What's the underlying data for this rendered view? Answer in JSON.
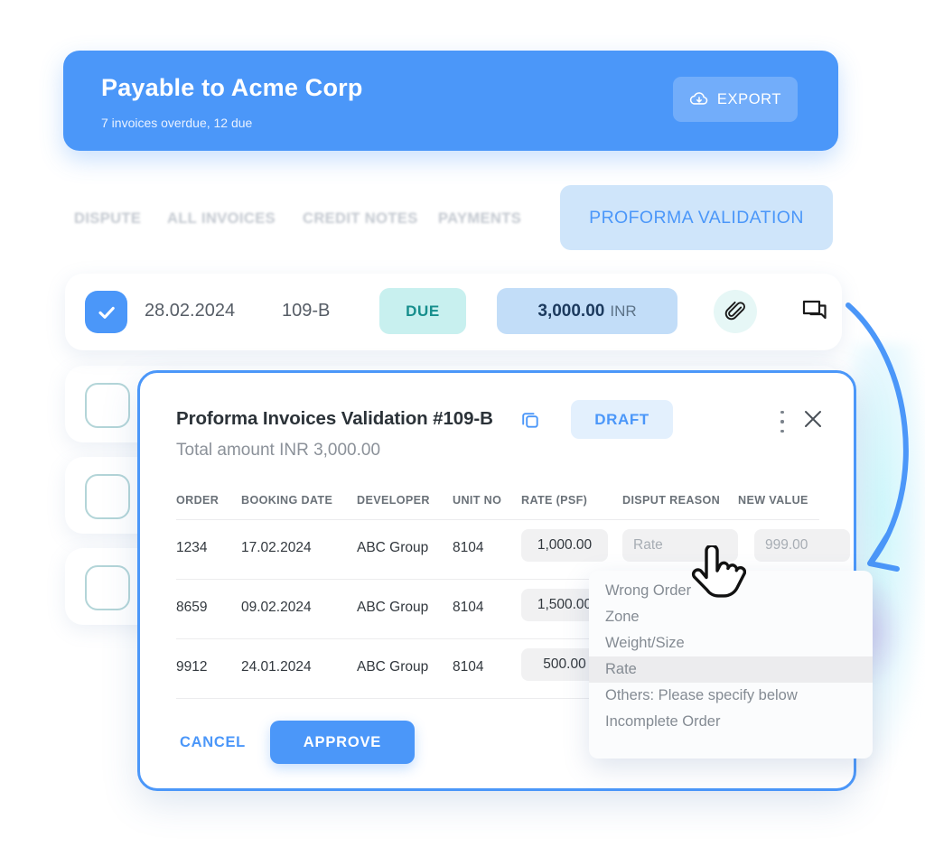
{
  "banner": {
    "title": "Payable to Acme Corp",
    "subtitle": "7 invoices overdue, 12 due",
    "export_label": "EXPORT",
    "export_icon": "cloud-download-icon",
    "accent": "#4b97f9"
  },
  "tabs": {
    "items": [
      {
        "label": "DISPUTE",
        "active": false
      },
      {
        "label": "ALL INVOICES",
        "active": false
      },
      {
        "label": "CREDIT NOTES",
        "active": false
      },
      {
        "label": "PAYMENTS",
        "active": false
      }
    ],
    "active_label": "PROFORMA VALIDATION",
    "active_color": "#4b97f9",
    "active_bg": "#cfe5fa"
  },
  "invoice_row": {
    "checked": true,
    "check_icon": "checkmark-icon",
    "date": "28.02.2024",
    "number": "109-B",
    "status": "DUE",
    "status_color": "#168e8c",
    "status_bg": "#c8f0ef",
    "amount": "3,000.00",
    "currency": "INR",
    "amount_bg": "#c2ddf8",
    "attachment_icon": "paperclip-icon",
    "comment_icon": "chat-icon"
  },
  "modal": {
    "title": "Proforma Invoices Validation #109-B",
    "copy_icon": "copy-icon",
    "badge": "DRAFT",
    "badge_color": "#4b97f9",
    "badge_bg": "#e3f0fd",
    "menu_icon": "more-vertical-icon",
    "close_icon": "close-icon",
    "subtitle": "Total amount INR 3,000.00",
    "table": {
      "columns": [
        "ORDER",
        "BOOKING DATE",
        "DEVELOPER",
        "UNIT NO",
        "RATE (PSF)",
        "DISPUT REASON",
        "NEW VALUE"
      ],
      "rows": [
        {
          "order": "1234",
          "booking_date": "17.02.2024",
          "developer": "ABC Group",
          "unit_no": "8104",
          "rate": "1,000.00",
          "disput_reason_placeholder": "Rate",
          "disput_reason_value": "",
          "new_value_placeholder": "999.00",
          "new_value": ""
        },
        {
          "order": "8659",
          "booking_date": "09.02.2024",
          "developer": "ABC Group",
          "unit_no": "8104",
          "rate": "1,500.00",
          "disput_reason_placeholder": "",
          "disput_reason_value": "",
          "new_value_placeholder": "",
          "new_value": ""
        },
        {
          "order": "9912",
          "booking_date": "24.01.2024",
          "developer": "ABC Group",
          "unit_no": "8104",
          "rate": "500.00",
          "disput_reason_placeholder": "",
          "disput_reason_value": "",
          "new_value_placeholder": "",
          "new_value": ""
        }
      ]
    },
    "cancel_label": "CANCEL",
    "approve_label": "APPROVE"
  },
  "dropdown": {
    "options": [
      {
        "label": "Wrong Order",
        "selected": false
      },
      {
        "label": "Zone",
        "selected": false
      },
      {
        "label": "Weight/Size",
        "selected": false
      },
      {
        "label": "Rate",
        "selected": true
      },
      {
        "label": "Others: Please specify below",
        "selected": false
      },
      {
        "label": "Incomplete Order",
        "selected": false
      }
    ]
  },
  "cursor": {
    "icon": "pointing-hand-cursor"
  }
}
